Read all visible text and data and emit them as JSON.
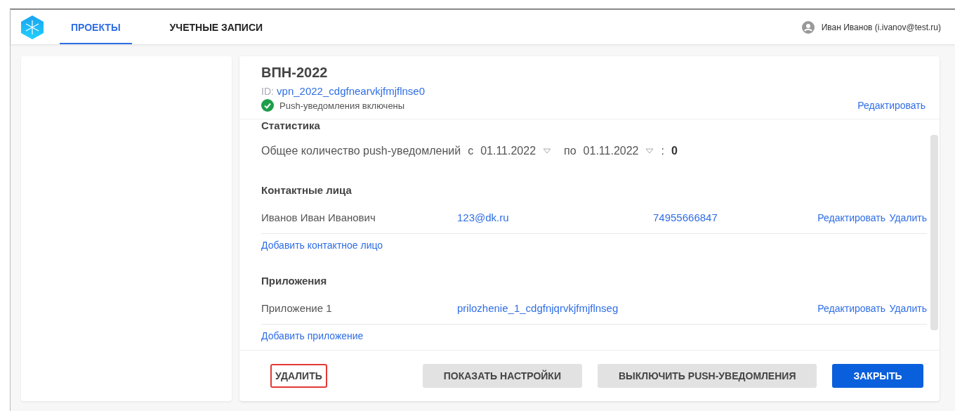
{
  "nav": {
    "tabs": [
      {
        "label": "ПРОЕКТЫ",
        "selected": true
      },
      {
        "label": "УЧЕТНЫЕ ЗАПИСИ",
        "selected": false
      }
    ],
    "user": "Иван Иванов (i.ivanov@test.ru)"
  },
  "project": {
    "title": "ВПН-2022",
    "id_label": "ID:",
    "id": "vpn_2022_cdgfnearvkjfmjflnse0",
    "push_enabled": true,
    "push_status": "Push-уведомления включены",
    "edit": "Редактировать"
  },
  "statistics": {
    "heading": "Статистика",
    "label": "Общее количество push-уведомлений",
    "from_label": "с",
    "from": "01.11.2022",
    "to_label": "по",
    "to": "01.11.2022",
    "colon": ":",
    "total": "0"
  },
  "contacts": {
    "heading": "Контактные лица",
    "rows": [
      {
        "name": "Иванов Иван Иванович",
        "email": "123@dk.ru",
        "phone": "74955666847",
        "edit": "Редактировать",
        "delete": "Удалить"
      }
    ],
    "add": "Добавить контактное лицо"
  },
  "apps": {
    "heading": "Приложения",
    "rows": [
      {
        "name": "Приложение 1",
        "id": "prilozhenie_1_cdgfnjqrvkjfmjflnseg",
        "edit": "Редактировать",
        "delete": "Удалить"
      }
    ],
    "add": "Добавить приложение"
  },
  "footer": {
    "buttons": [
      {
        "label": "УДАЛИТЬ",
        "kind": "text",
        "highlighted": true
      },
      {
        "label": "ПОКАЗАТЬ НАСТРОЙКИ",
        "kind": "secondary",
        "highlighted": false
      },
      {
        "label": "ВЫКЛЮЧИТЬ PUSH-УВЕДОМЛЕНИЯ",
        "kind": "secondary",
        "highlighted": false
      },
      {
        "label": "ЗАКРЫТЬ",
        "kind": "primary",
        "highlighted": false
      }
    ]
  }
}
